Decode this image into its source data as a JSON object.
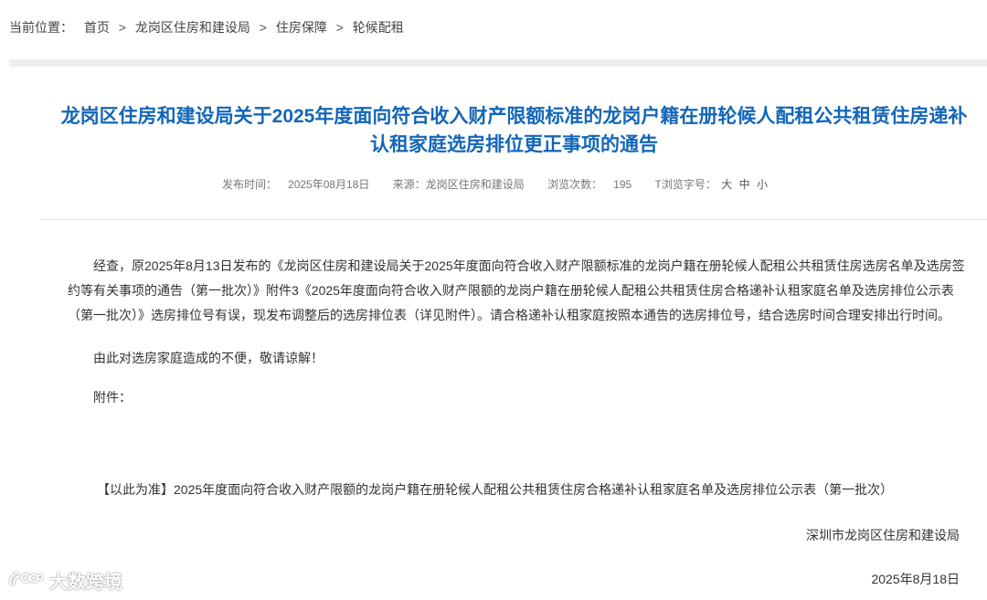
{
  "breadcrumb": {
    "prefix": "当前位置：",
    "items": [
      "首页",
      "龙岗区住房和建设局",
      "住房保障",
      "轮候配租"
    ],
    "separator": ">"
  },
  "article": {
    "title": "龙岗区住房和建设局关于2025年度面向符合收入财产限额标准的龙岗户籍在册轮候人配租公共租赁住房递补认租家庭选房排位更正事项的通告",
    "meta": {
      "publish_label": "发布时间：",
      "publish_date": "2025年08月18日",
      "source_label": "来源：",
      "source": "龙岗区住房和建设局",
      "views_label": "浏览次数：",
      "views": "195",
      "fontsize_label": "T浏览字号：",
      "fontsize_large": "大",
      "fontsize_medium": "中",
      "fontsize_small": "小"
    },
    "paragraphs": [
      "经查，原2025年8月13日发布的《龙岗区住房和建设局关于2025年度面向符合收入财产限额标准的龙岗户籍在册轮候人配租公共租赁住房选房名单及选房签约等有关事项的通告（第一批次）》附件3《2025年度面向符合收入财产限额的龙岗户籍在册轮候人配租公共租赁住房合格递补认租家庭名单及选房排位公示表（第一批次）》选房排位号有误，现发布调整后的选房排位表（详见附件）。请合格递补认租家庭按照本通告的选房排位号，结合选房时间合理安排出行时间。",
      "由此对选房家庭造成的不便，敬请谅解！",
      "附件："
    ],
    "attachment": "【以此为准】2025年度面向符合收入财产限额的龙岗户籍在册轮候人配租公共租赁住房合格递补认租家庭名单及选房排位公示表（第一批次）",
    "signature": "深圳市龙岗区住房和建设局",
    "sign_date": "2025年8月18日"
  },
  "watermark": {
    "text": "大数跨境",
    "icon": "weibo-logo-icon"
  },
  "colors": {
    "title": "#1366b8",
    "band": "#eeeeee",
    "text": "#333333"
  }
}
